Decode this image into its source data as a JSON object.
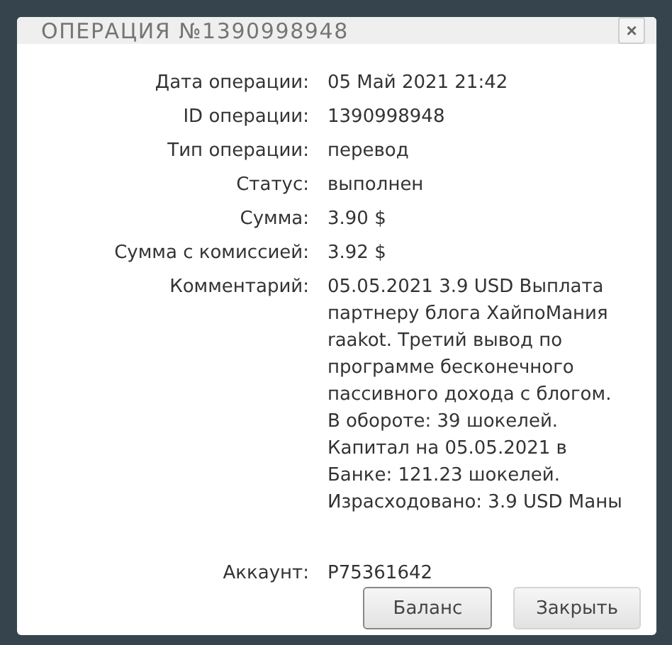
{
  "dialog": {
    "title": "ОПЕРАЦИЯ №1390998948",
    "close_icon": "×"
  },
  "fields": [
    {
      "label": "Дата операции:",
      "value": "05 Май 2021 21:42"
    },
    {
      "label": "ID операции:",
      "value": "1390998948"
    },
    {
      "label": "Тип операции:",
      "value": "перевод"
    },
    {
      "label": "Статус:",
      "value": "выполнен"
    },
    {
      "label": "Сумма:",
      "value": "3.90 $"
    },
    {
      "label": "Сумма с комиссией:",
      "value": "3.92 $"
    },
    {
      "label": "Комментарий:",
      "value": "05.05.2021 3.9 USD Выплата партнеру блога ХайпоМания raakot. Третий вывод по программе бесконечного пассивного дохода с блогом. В обороте: 39 шокелей. Капитал на 05.05.2021 в Банке: 121.23 шокелей. Израсходовано: 3.9 USD Маны"
    }
  ],
  "account": {
    "label": "Аккаунт:",
    "value": "P75361642"
  },
  "buttons": [
    "Баланс",
    "Закрыть"
  ]
}
